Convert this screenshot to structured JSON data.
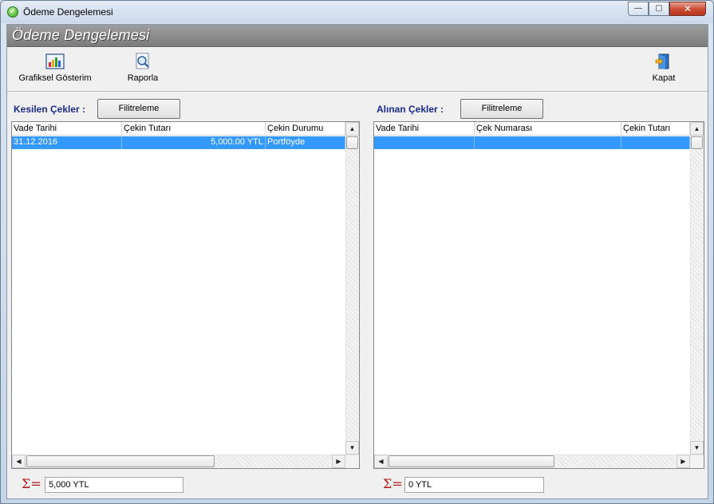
{
  "window": {
    "title": "Ödeme Dengelemesi",
    "buttons": {
      "minimize": "—",
      "maximize": "▢",
      "close": "✕"
    }
  },
  "header": {
    "title": "Ödeme Dengelemesi"
  },
  "toolbar": {
    "graph_label": "Grafiksel Gösterim",
    "report_label": "Raporla",
    "close_label": "Kapat"
  },
  "left_panel": {
    "label": "Kesilen Çekler :",
    "filter_label": "Filitreleme",
    "columns": [
      "Vade Tarihi",
      "Çekin Tutarı",
      "Çekin Durumu"
    ],
    "rows": [
      {
        "date": "31.12.2016",
        "amount": "5,000.00 YTL",
        "status": "Portföyde"
      }
    ],
    "total": "5,000  YTL"
  },
  "right_panel": {
    "label": "Alınan Çekler :",
    "filter_label": "Filitreleme",
    "columns": [
      "Vade Tarihi",
      "Çek Numarası",
      "Çekin Tutarı"
    ],
    "rows": [
      {
        "date": "",
        "number": "",
        "amount": ""
      }
    ],
    "total": "0  YTL"
  },
  "colors": {
    "selection": "#3399ff",
    "section_label": "#1b2a8c",
    "sigma": "#b01818",
    "header_band": "#8a8a8a"
  },
  "icons": {
    "app": "check-circle-icon",
    "graph": "bar-chart-icon",
    "report": "magnifier-document-icon",
    "close": "exit-door-icon",
    "sum": "sigma-equals-icon"
  }
}
